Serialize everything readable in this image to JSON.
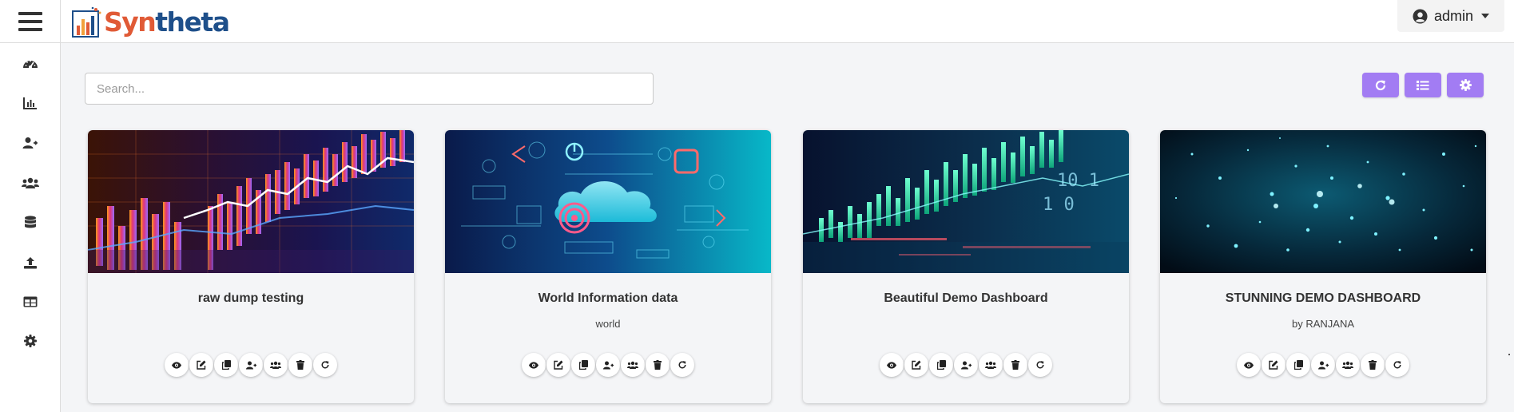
{
  "app": {
    "logo_syn": "Syn",
    "logo_theta": "theta"
  },
  "user": {
    "name": "admin",
    "icon": "user-circle-icon"
  },
  "sidebar": {
    "items": [
      {
        "icon": "dashboard-gauge-icon"
      },
      {
        "icon": "bar-chart-icon"
      },
      {
        "icon": "user-share-icon"
      },
      {
        "icon": "users-icon"
      },
      {
        "icon": "database-icon"
      },
      {
        "icon": "upload-icon"
      },
      {
        "icon": "table-icon"
      },
      {
        "icon": "gear-icon"
      }
    ]
  },
  "search": {
    "placeholder": "Search...",
    "value": ""
  },
  "toolbar": {
    "buttons": [
      "refresh-icon",
      "list-view-icon",
      "settings-gear-icon"
    ],
    "color": "#a27cf3"
  },
  "cards": [
    {
      "title": "raw dump testing",
      "subtitle": "",
      "theme": "financial-chart-colorful"
    },
    {
      "title": "World Information data",
      "subtitle": "world",
      "theme": "cloud-technology"
    },
    {
      "title": "Beautiful Demo Dashboard",
      "subtitle": "",
      "theme": "financial-chart-teal"
    },
    {
      "title": "STUNNING DEMO DASHBOARD",
      "subtitle": "by RANJANA",
      "theme": "particles-cyan"
    }
  ],
  "card_actions": [
    "view-icon",
    "edit-icon",
    "copy-icon",
    "share-user-icon",
    "share-group-icon",
    "delete-icon",
    "refresh-icon"
  ]
}
